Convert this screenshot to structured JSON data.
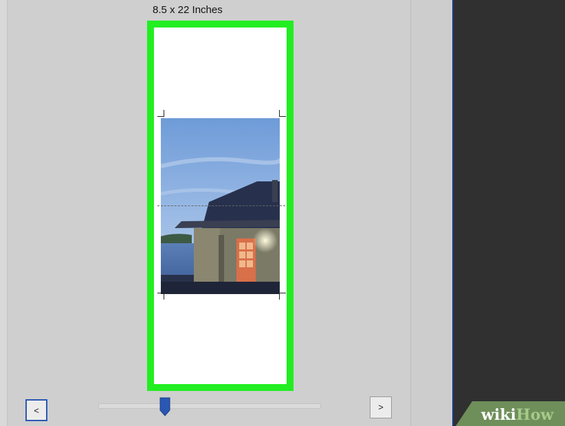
{
  "preview": {
    "size_label": "8.5 x 22 Inches",
    "frame_color": "#22ee22"
  },
  "navigation": {
    "prev_label": "<",
    "next_label": ">",
    "slider_value": 0.3
  },
  "watermark": {
    "part1": "wiki",
    "part2": "How"
  },
  "colors": {
    "accent": "#2a57b4",
    "dark_panel": "#303030",
    "panel": "#cfcfcf"
  }
}
